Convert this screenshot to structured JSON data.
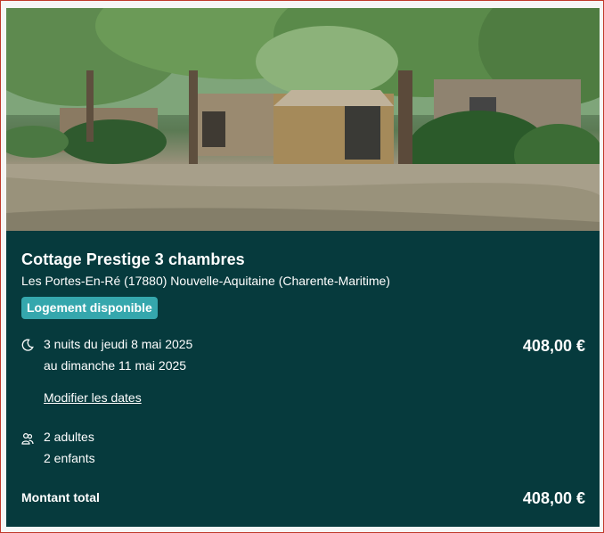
{
  "listing": {
    "title": "Cottage Prestige 3 chambres",
    "location": "Les Portes-En-Ré (17880)  Nouvelle-Aquitaine (Charente-Maritime)",
    "availability_badge": "Logement disponible"
  },
  "stay": {
    "dates_line1": "3 nuits du jeudi 8 mai 2025",
    "dates_line2": "au dimanche 11 mai 2025",
    "price": "408,00 €",
    "modify_link": "Modifier les dates"
  },
  "guests": {
    "adults": "2 adultes",
    "children": "2 enfants"
  },
  "total": {
    "label": "Montant total",
    "price": "408,00 €"
  },
  "icons": {
    "dates": "moon-icon",
    "guests": "people-icon"
  },
  "colors": {
    "card_background": "#063a3d",
    "badge_background": "#35a7ad",
    "text": "#ffffff"
  }
}
